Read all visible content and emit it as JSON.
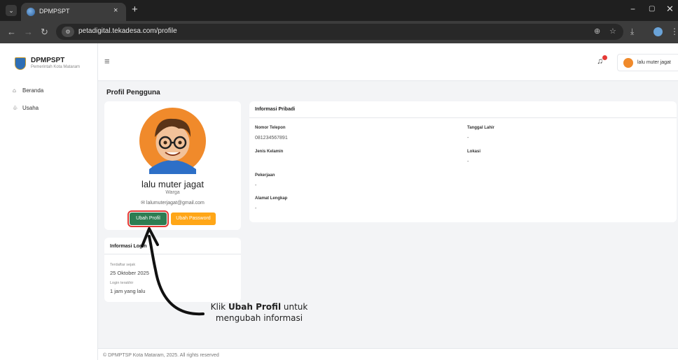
{
  "browser": {
    "tab_title": "DPMPSPT",
    "tab_close": "×",
    "new_tab": "+",
    "url": "petadigital.tekadesa.com/profile",
    "min": "−",
    "max": "▢",
    "close": "✕"
  },
  "brand": {
    "title": "DPMPSPT",
    "subtitle": "Pemerintah Kota Mataram"
  },
  "sidebar": {
    "items": [
      {
        "label": "Beranda",
        "icon": "home-icon"
      },
      {
        "label": "Usaha",
        "icon": "business-icon"
      }
    ]
  },
  "topbar": {
    "user_name": "lalu muter jagat",
    "notification_count": "1"
  },
  "page": {
    "title": "Profil Pengguna"
  },
  "profile": {
    "name": "lalu muter jagat",
    "role": "Warga",
    "email": "lalumuterjagat@gmail.com",
    "edit_button": "Ubah Profil",
    "password_button": "Ubah Password"
  },
  "personal_info": {
    "header": "Informasi Pribadi",
    "phone_label": "Nomor Telepon",
    "phone_value": "081234567891",
    "birthdate_label": "Tanggal Lahir",
    "birthdate_value": "-",
    "gender_label": "Jenis Kelamin",
    "gender_value": "",
    "location_label": "Lokasi",
    "location_value": "-",
    "job_label": "Pekerjaan",
    "job_value": "-",
    "address_label": "Alamat Lengkap",
    "address_value": "-"
  },
  "login_info": {
    "header": "Informasi Login",
    "registered_label": "Terdaftar sejak",
    "registered_value": "25 Oktober 2025",
    "last_login_label": "Login terakhir",
    "last_login_value": "1 jam yang lalu"
  },
  "annotation": {
    "prefix": "Klik ",
    "bold": "Ubah Profil",
    "suffix": " untuk",
    "line2": "mengubah informasi"
  },
  "footer": {
    "text": "© DPMPTSP Kota Mataram, 2025. All rights reserved"
  },
  "colors": {
    "edit_button": "#2e7d52",
    "password_button": "#ffa617",
    "highlight": "#e53935"
  }
}
